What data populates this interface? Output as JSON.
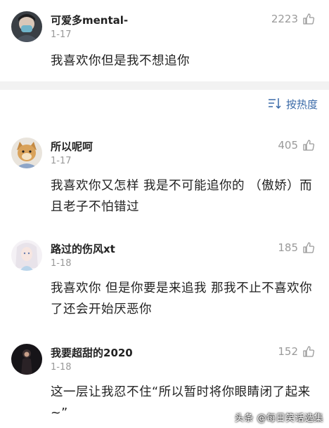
{
  "comments": [
    {
      "username": "可爱多mental-",
      "date": "1-17",
      "likes": "2223",
      "text": "我喜欢你但是我不想追你"
    },
    {
      "username": "所以呢呵",
      "date": "1-17",
      "likes": "405",
      "text": "我喜欢你又怎样  我是不可能追你的 （傲娇）而且老子不怕错过"
    },
    {
      "username": "路过的伤风xt",
      "date": "1-18",
      "likes": "185",
      "text": "我喜欢你 但是你要是来追我 那我不止不喜欢你了还会开始厌恶你"
    },
    {
      "username": "我要超甜的2020",
      "date": "1-18",
      "likes": "152",
      "text": "这一层让我忍不住“所以暂时将你眼睛闭了起来~”"
    }
  ],
  "sort": {
    "label": "按热度"
  },
  "watermark": "头条 @每日笑话选集"
}
